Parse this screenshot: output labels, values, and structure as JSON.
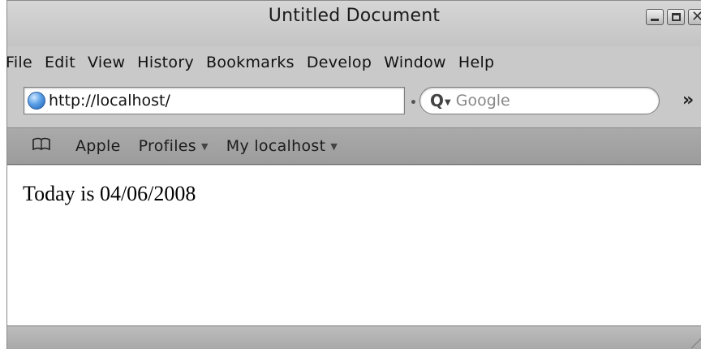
{
  "window": {
    "title": "Untitled Document"
  },
  "menu": [
    "File",
    "Edit",
    "View",
    "History",
    "Bookmarks",
    "Develop",
    "Window",
    "Help"
  ],
  "toolbar": {
    "url": "http://localhost/",
    "search_placeholder": "Google",
    "overflow_glyph": "»"
  },
  "bookmarks": {
    "items": [
      {
        "label": "Apple",
        "has_menu": false
      },
      {
        "label": "Profiles",
        "has_menu": true
      },
      {
        "label": "My localhost",
        "has_menu": true
      }
    ]
  },
  "content": {
    "text": "Today is 04/06/2008"
  },
  "icons": {
    "site": "globe-icon",
    "search": "search-icon",
    "bookmarks": "open-book-icon",
    "minimize": "minimize-icon",
    "maximize": "maximize-icon",
    "close": "close-icon"
  }
}
